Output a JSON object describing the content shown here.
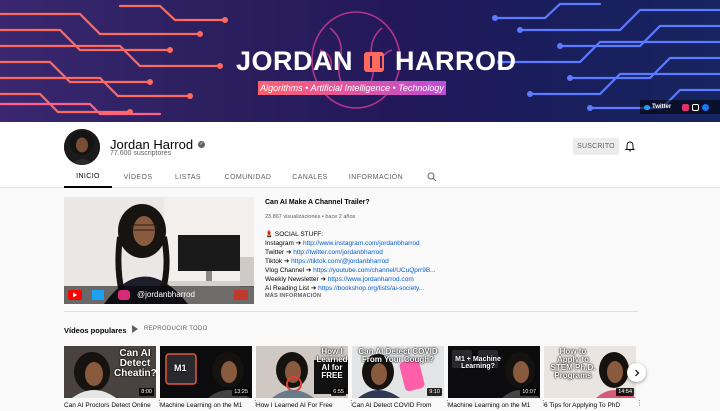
{
  "banner": {
    "title_left": "JORDAN",
    "title_right": "HARROD",
    "tagline": "Algorithms • Artificial Intelligence • Technology",
    "link_label": "Twitter",
    "colors": {
      "primary": "#2b1f5e",
      "accent": "#ff5f6d",
      "line_left": "#ff6a5c",
      "line_right": "#5d7bff"
    }
  },
  "channel": {
    "name": "Jordan Harrod",
    "subscribers": "77.600 suscriptores",
    "subscribe_label": "SUSCRITO",
    "bell_icon": "bell-icon"
  },
  "tabs": [
    {
      "label": "INICIO",
      "active": true
    },
    {
      "label": "VÍDEOS",
      "active": false
    },
    {
      "label": "LISTAS",
      "active": false
    },
    {
      "label": "COMUNIDAD",
      "active": false
    },
    {
      "label": "CANALES",
      "active": false
    },
    {
      "label": "INFORMACIÓN",
      "active": false
    }
  ],
  "featured": {
    "title": "Can AI Make A Channel Trailer?",
    "meta": "23.867 visualizaciones • hace 2 años",
    "overlay_handle": "@jordanbharrod",
    "desc_heading": "SOCIAL STUFF:",
    "desc_lines": [
      {
        "label": "Instagram ➔ ",
        "link": "http://www.instagram.com/jordanbharrod"
      },
      {
        "label": "Twitter ➔ ",
        "link": "http://twitter.com/jordanbharrod"
      },
      {
        "label": "Tiktok ➔ ",
        "link": "https://tiktok.com/@jordanbharrod"
      },
      {
        "label": "Vlog Channel ➔ ",
        "link": "https://youtube.com/channel/UCuQprr9B..."
      },
      {
        "label": "Weekly Newsletter ➔ ",
        "link": "https://www.jordanharrod.com"
      },
      {
        "label": "AI Reading List ➔ ",
        "link": "https://bookshop.org/lists/ai-society..."
      }
    ],
    "more_info": "MÁS INFORMACIÓN"
  },
  "popular": {
    "title": "Vídeos populares",
    "play_all": "REPRODUCIR TODO",
    "videos": [
      {
        "title": "Can AI Proctors Detect Online",
        "duration": "8:00",
        "overlay": "Can AI Detect Cheatin?"
      },
      {
        "title": "Machine Learning on the M1",
        "duration": "13:25",
        "overlay": "M1"
      },
      {
        "title": "How I Learned AI For Free",
        "duration": "6:55",
        "overlay": "How I Learned AI for FREE"
      },
      {
        "title": "Can AI Detect COVID From",
        "duration": "9:10",
        "overlay": "Can AI Detect COVID From Your Cough?"
      },
      {
        "title": "Machine Learning on the M1",
        "duration": "10:07",
        "overlay": "M1 + Machine Learning?"
      },
      {
        "title": "6 Tips for Applying To PhD",
        "duration": "14:54",
        "overlay": "How to Apply to STEM Ph.D. Programs"
      }
    ]
  }
}
